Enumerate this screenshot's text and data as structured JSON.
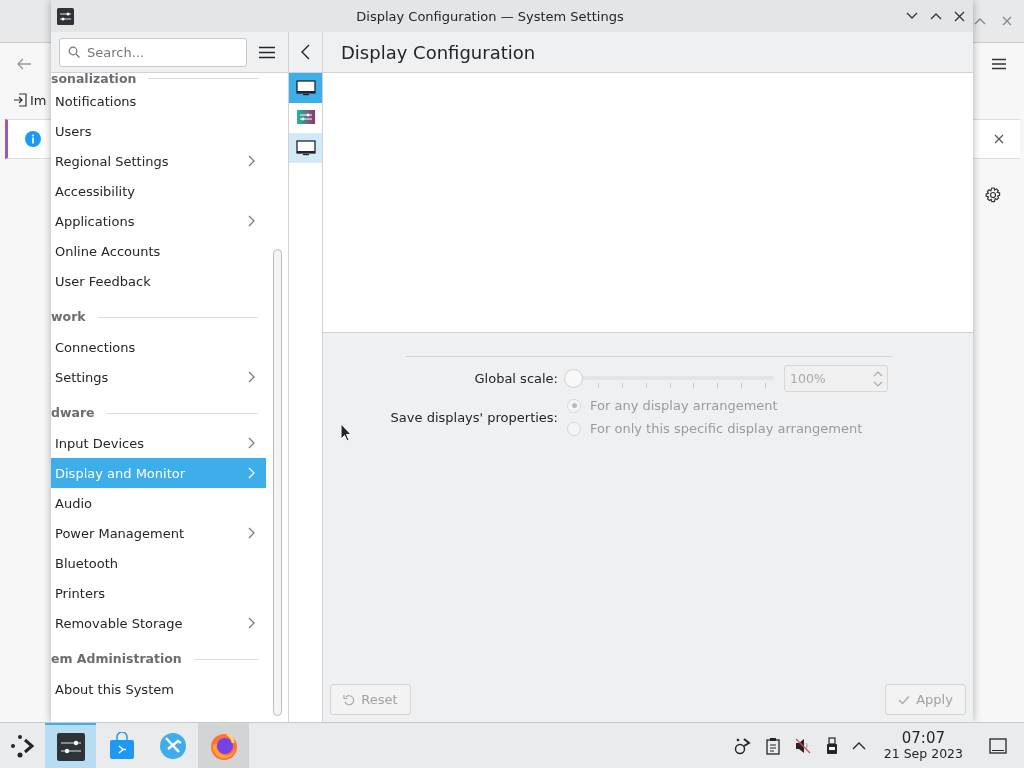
{
  "background_window": {
    "toolbar_text": "Im"
  },
  "window": {
    "title": "Display Configuration — System Settings"
  },
  "sidebar": {
    "search": {
      "placeholder": "Search..."
    },
    "items": [
      {
        "kind": "header",
        "label": "sonalization"
      },
      {
        "kind": "item",
        "label": "Notifications",
        "expandable": false,
        "selected": false
      },
      {
        "kind": "item",
        "label": "Users",
        "expandable": false,
        "selected": false
      },
      {
        "kind": "item",
        "label": "Regional Settings",
        "expandable": true,
        "selected": false
      },
      {
        "kind": "item",
        "label": "Accessibility",
        "expandable": false,
        "selected": false
      },
      {
        "kind": "item",
        "label": "Applications",
        "expandable": true,
        "selected": false
      },
      {
        "kind": "item",
        "label": "Online Accounts",
        "expandable": false,
        "selected": false
      },
      {
        "kind": "item",
        "label": "User Feedback",
        "expandable": false,
        "selected": false
      },
      {
        "kind": "header",
        "label": "work"
      },
      {
        "kind": "item",
        "label": "Connections",
        "expandable": false,
        "selected": false
      },
      {
        "kind": "item",
        "label": "Settings",
        "expandable": true,
        "selected": false
      },
      {
        "kind": "header",
        "label": "dware"
      },
      {
        "kind": "item",
        "label": "Input Devices",
        "expandable": true,
        "selected": false
      },
      {
        "kind": "item",
        "label": "Display and Monitor",
        "expandable": true,
        "selected": true
      },
      {
        "kind": "item",
        "label": "Audio",
        "expandable": false,
        "selected": false
      },
      {
        "kind": "item",
        "label": "Power Management",
        "expandable": true,
        "selected": false
      },
      {
        "kind": "item",
        "label": "Bluetooth",
        "expandable": false,
        "selected": false
      },
      {
        "kind": "item",
        "label": "Printers",
        "expandable": false,
        "selected": false
      },
      {
        "kind": "item",
        "label": "Removable Storage",
        "expandable": true,
        "selected": false
      },
      {
        "kind": "header",
        "label": "em Administration"
      },
      {
        "kind": "item",
        "label": "About this System",
        "expandable": false,
        "selected": false
      }
    ]
  },
  "subpages": [
    {
      "kind": "monitor",
      "selected": true,
      "hovered": false
    },
    {
      "kind": "settings",
      "selected": false,
      "hovered": false
    },
    {
      "kind": "monitor",
      "selected": false,
      "hovered": true
    }
  ],
  "page": {
    "title": "Display Configuration",
    "global_scale": {
      "label": "Global scale:",
      "level": 0,
      "value": "100%",
      "disabled": true
    },
    "save_properties": {
      "label": "Save displays' properties:",
      "disabled": true,
      "options": [
        {
          "label": "For any display arrangement",
          "selected": true
        },
        {
          "label": "For only this specific display arrangement",
          "selected": false
        }
      ]
    },
    "buttons": [
      {
        "kind": "reset",
        "label": "Reset",
        "disabled": true
      },
      {
        "kind": "apply",
        "label": "Apply",
        "disabled": true
      }
    ]
  },
  "taskbar": {
    "tasks": [
      {
        "kind": "settings",
        "active": true,
        "hovered": false
      },
      {
        "kind": "store",
        "active": false,
        "hovered": false
      },
      {
        "kind": "globe",
        "active": false,
        "hovered": false
      },
      {
        "kind": "firefox",
        "active": false,
        "hovered": true
      }
    ],
    "clock": {
      "time": "07:07",
      "date": "21 Sep 2023"
    }
  }
}
